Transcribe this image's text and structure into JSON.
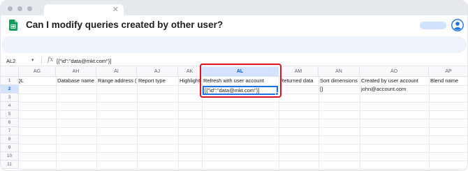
{
  "window": {
    "tab_close": "✕",
    "title": "Can I modify queries created by other user?",
    "colors": {
      "accent": "#1a73e8",
      "highlight": "#e0101e",
      "sheets_green": "#0f9d58"
    }
  },
  "formula_bar": {
    "name_box": "AL2",
    "name_box_arrow": "▾",
    "fx": "fx",
    "formula": "[{\"id\":\"data@mkt.com\"}]"
  },
  "columns": [
    "AG",
    "AH",
    "AI",
    "AJ",
    "AK",
    "AL",
    "AM",
    "AN",
    "AO",
    "AP"
  ],
  "active_column": "AL",
  "rows": [
    "1",
    "2",
    "3",
    "4",
    "5",
    "6",
    "7",
    "8",
    "9",
    "10",
    "11"
  ],
  "active_row": "2",
  "row1": {
    "AG": "SQL",
    "AH": "Database name",
    "AI": "Range address (",
    "AJ": "Report type",
    "AK": "Highlight",
    "AL": "Refresh with user account",
    "AM": "Returned data",
    "AN": "Sort dimensions",
    "AO": "Created by user account",
    "AP": "Blend name"
  },
  "row2": {
    "AL": "[{\"id\":\"data@mkt.com\"}]",
    "AN": "[]",
    "AO": "john@account.com"
  },
  "icons": {
    "sheets": "google-sheets-icon",
    "avatar": "account-avatar-icon",
    "fx": "function-icon"
  }
}
